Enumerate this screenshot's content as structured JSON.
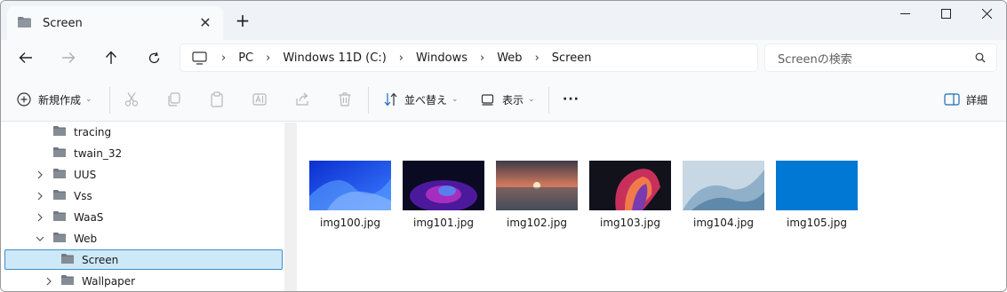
{
  "window": {
    "tab_title": "Screen",
    "new_tab": "+",
    "close_tab": "✕",
    "controls": {
      "minimize": "—",
      "maximize": "☐",
      "close": "✕"
    }
  },
  "address": {
    "crumbs": [
      "PC",
      "Windows 11D (C:)",
      "Windows",
      "Web",
      "Screen"
    ],
    "separator": "›"
  },
  "search": {
    "placeholder": "Screenの検索"
  },
  "toolbar": {
    "new_label": "新規作成",
    "sort_label": "並べ替え",
    "view_label": "表示",
    "more_label": "···",
    "details_label": "詳細"
  },
  "nav": {
    "items": [
      {
        "label": "tracing",
        "expandable": false
      },
      {
        "label": "twain_32",
        "expandable": false
      },
      {
        "label": "UUS",
        "expandable": true
      },
      {
        "label": "Vss",
        "expandable": true
      },
      {
        "label": "WaaS",
        "expandable": true
      },
      {
        "label": "Web",
        "expandable": true,
        "expanded": true
      },
      {
        "label": "Screen",
        "expandable": false,
        "selected": true
      },
      {
        "label": "Wallpaper",
        "expandable": true
      }
    ]
  },
  "files": [
    {
      "name": "img100.jpg"
    },
    {
      "name": "img101.jpg"
    },
    {
      "name": "img102.jpg"
    },
    {
      "name": "img103.jpg"
    },
    {
      "name": "img104.jpg"
    },
    {
      "name": "img105.jpg"
    }
  ],
  "colors": {
    "accent": "#0078d4",
    "selection_bg": "#cde8f7",
    "selection_border": "#3d8fd0",
    "folder": "#6f7782"
  }
}
